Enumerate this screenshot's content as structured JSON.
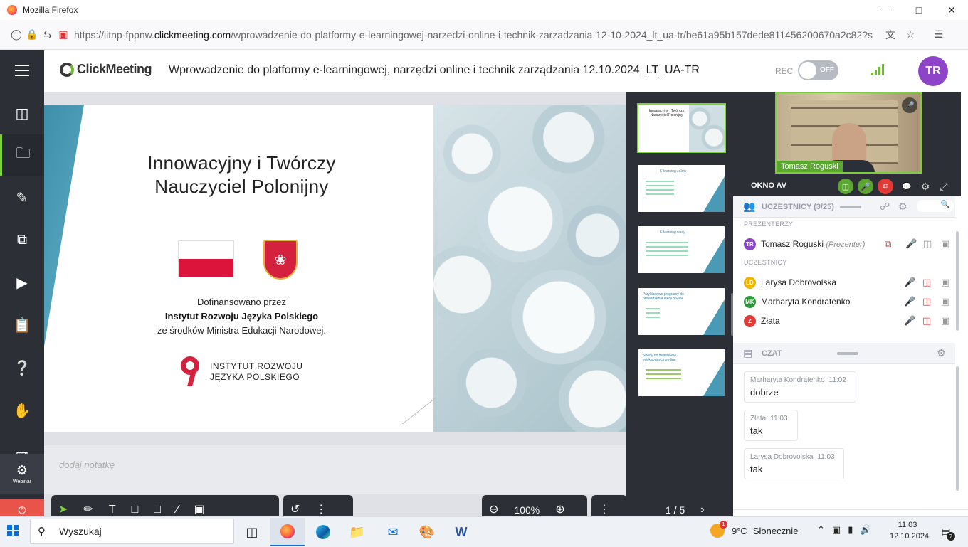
{
  "browser": {
    "window_title": "Mozilla Firefox",
    "url_prefix": "https://iitnp-fppnw.",
    "url_domain": "clickmeeting.com",
    "url_rest": "/wprowadzenie-do-platformy-e-learningowej-narzedzi-online-i-technik-zarzadzania-12-10-2024_lt_ua-tr/be61a95b157dede811456200670a2c82?s",
    "icons": [
      "shield-icon",
      "lock-icon",
      "permissions-icon",
      "camera-sharing-icon",
      "translate-icon",
      "star-icon",
      "menu-icon"
    ]
  },
  "app": {
    "logo_text": "ClickMeeting",
    "meeting_title": "Wprowadzenie do platformy e-learningowej, narzędzi online i technik zarządzania 12.10.2024_LT_UA-TR",
    "rec_label": "REC",
    "rec_toggle": "OFF",
    "user_initials": "TR",
    "accent_color": "#7ccf3a",
    "avatar_color": "#8e44c9"
  },
  "nav": {
    "webinar_label": "Webinar"
  },
  "slide": {
    "title_line1": "Innowacyjny i Twórczy",
    "title_line2": "Nauczyciel Polonijny",
    "funding_line1": "Dofinansowano przez",
    "funding_line2": "Instytut Rozwoju Języka Polskiego",
    "funding_line3": "ze środków Ministra Edukacji Narodowej.",
    "logo_line1": "INSTYTUT ROZWOJU",
    "logo_line2": "JĘZYKA POLSKIEGO"
  },
  "notes": {
    "placeholder": "dodaj notatkę"
  },
  "toolbar": {
    "zoom": "100%",
    "page": "1 / 5"
  },
  "thumbnails": [
    {
      "title": "Innowacyjny i Twórczy Nauczyciel Polonijny"
    },
    {
      "title": "E-learning zalety"
    },
    {
      "title": "E-learning wady"
    },
    {
      "title": "Przykładowe programy do prowadzenia lekcji on-line"
    },
    {
      "title": "Strony do materiałów edukacyjnych on-line"
    }
  ],
  "video": {
    "presenter_name": "Tomasz Roguski",
    "av_label": "OKNO AV"
  },
  "participants": {
    "header": "UCZESTNICY (3/25)",
    "presenters_group": "PREZENTERZY",
    "attendees_group": "UCZESTNICY",
    "presenters": [
      {
        "initials": "TR",
        "name": "Tomasz Roguski",
        "role": "(Prezenter)",
        "color": "#8e44c9"
      }
    ],
    "attendees": [
      {
        "initials": "LD",
        "name": "Larysa Dobrovolska",
        "color": "#f0b400"
      },
      {
        "initials": "MK",
        "name": "Marharyta Kondratenko",
        "color": "#2e9b3a"
      },
      {
        "initials": "Z",
        "name": "Złata",
        "color": "#e53935"
      }
    ]
  },
  "chat": {
    "header": "CZAT",
    "messages": [
      {
        "author": "Marharyta Kondratenko",
        "time": "11:02",
        "text": "dobrze"
      },
      {
        "author": "Złata",
        "time": "11:03",
        "text": "tak"
      },
      {
        "author": "Larysa Dobrovolska",
        "time": "11:03",
        "text": "tak"
      }
    ]
  },
  "taskbar": {
    "search_placeholder": "Wyszukaj",
    "weather_temp": "9°C",
    "weather_desc": "Słonecznie",
    "weather_badge": "1",
    "time": "11:03",
    "date": "12.10.2024",
    "notifications": "7"
  }
}
